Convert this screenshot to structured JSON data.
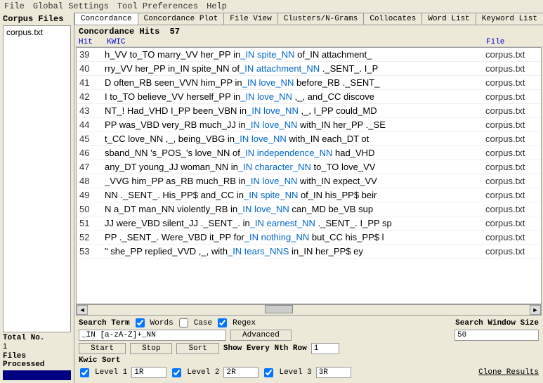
{
  "menu": [
    "File",
    "Global Settings",
    "Tool Preferences",
    "Help"
  ],
  "left": {
    "title": "Corpus Files",
    "files": [
      "corpus.txt"
    ],
    "total_label": "Total No.",
    "total_val": "1",
    "processed_label": "Files Processed"
  },
  "tabs": [
    "Concordance",
    "Concordance Plot",
    "File View",
    "Clusters/N-Grams",
    "Collocates",
    "Word List",
    "Keyword List"
  ],
  "hits_label": "Concordance Hits",
  "hits_count": "57",
  "headers": {
    "hit": "Hit",
    "kwic": "KWIC",
    "file": "File"
  },
  "rows": [
    {
      "n": "39",
      "pre": "h_VV to_TO marry_VV her_PP in",
      "kw": "_IN spite_NN",
      "post": " of_IN attachment_",
      "f": "corpus.txt"
    },
    {
      "n": "40",
      "pre": "rry_VV her_PP in_IN spite_NN of",
      "kw": "_IN attachment_NN",
      "post": " ._SENT_. I_P",
      "f": "corpus.txt"
    },
    {
      "n": "41",
      "pre": "D often_RB seen_VVN him_PP in",
      "kw": "_IN love_NN",
      "post": " before_RB ._SENT_",
      "f": "corpus.txt"
    },
    {
      "n": "42",
      "pre": "I to_TO believe_VV herself_PP in",
      "kw": "_IN love_NN",
      "post": " ,_, and_CC discove",
      "f": "corpus.txt"
    },
    {
      "n": "43",
      "pre": "NT_! Had_VHD I_PP been_VBN in",
      "kw": "_IN love_NN",
      "post": " ,_, I_PP could_MD",
      "f": "corpus.txt"
    },
    {
      "n": "44",
      "pre": "PP was_VBD very_RB much_JJ in",
      "kw": "_IN love_NN",
      "post": " with_IN her_PP ._SE",
      "f": "corpus.txt"
    },
    {
      "n": "45",
      "pre": "t_CC love_NN ,_, being_VBG in",
      "kw": "_IN love_NN",
      "post": " with_IN each_DT ot",
      "f": "corpus.txt"
    },
    {
      "n": "46",
      "pre": "sband_NN 's_POS_'s love_NN of",
      "kw": "_IN independence_NN",
      "post": " had_VHD",
      "f": "corpus.txt"
    },
    {
      "n": "47",
      "pre": "any_DT young_JJ woman_NN in",
      "kw": "_IN character_NN",
      "post": " to_TO love_VV",
      "f": "corpus.txt"
    },
    {
      "n": "48",
      "pre": "_VVG him_PP as_RB much_RB in",
      "kw": "_IN love_NN",
      "post": " with_IN expect_VV",
      "f": "corpus.txt"
    },
    {
      "n": "49",
      "pre": "NN ._SENT_. His_PP$ and_CC in",
      "kw": "_IN spite_NN",
      "post": " of_IN his_PP$ beir",
      "f": "corpus.txt"
    },
    {
      "n": "50",
      "pre": "N a_DT man_NN violently_RB in",
      "kw": "_IN love_NN",
      "post": " can_MD be_VB sup",
      "f": "corpus.txt"
    },
    {
      "n": "51",
      "pre": "JJ were_VBD silent_JJ ._SENT_. in",
      "kw": "_IN earnest_NN",
      "post": " ._SENT_. I_PP sp",
      "f": "corpus.txt"
    },
    {
      "n": "52",
      "pre": "PP ._SENT_. Were_VBD it_PP for",
      "kw": "_IN nothing_NN",
      "post": " but_CC his_PP$ l",
      "f": "corpus.txt"
    },
    {
      "n": "53",
      "pre": "\" she_PP replied_VVD ,_, with",
      "kw": "_IN tears_NNS",
      "post": " in_IN her_PP$ ey",
      "f": "corpus.txt"
    }
  ],
  "search": {
    "label": "Search Term",
    "words": "Words",
    "case": "Case",
    "regex": "Regex",
    "value": "_IN [a-zA-Z]+_NN",
    "advanced": "Advanced",
    "start": "Start",
    "stop": "Stop",
    "sort": "Sort",
    "nth_label": "Show Every Nth Row",
    "nth_val": "1",
    "sws_label": "Search Window Size",
    "sws_val": "50"
  },
  "kwic": {
    "label": "Kwic Sort",
    "l1": "Level 1",
    "v1": "1R",
    "l2": "Level 2",
    "v2": "2R",
    "l3": "Level 3",
    "v3": "3R",
    "clone": "Clone Results"
  }
}
